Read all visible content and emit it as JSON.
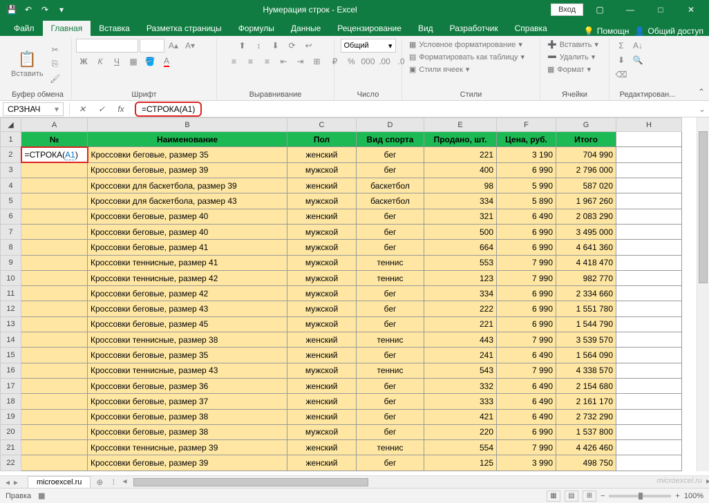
{
  "title": "Нумерация строк  -  Excel",
  "signin": "Вход",
  "tabs": {
    "file": "Файл",
    "home": "Главная",
    "insert": "Вставка",
    "layout": "Разметка страницы",
    "formulas": "Формулы",
    "data": "Данные",
    "review": "Рецензирование",
    "view": "Вид",
    "developer": "Разработчик",
    "help": "Справка"
  },
  "ribbon_help": {
    "tell": "Помощн",
    "share": "Общий доступ"
  },
  "ribbon": {
    "clipboard": {
      "paste": "Вставить",
      "label": "Буфер обмена"
    },
    "font": {
      "label": "Шрифт",
      "bold": "Ж",
      "italic": "К",
      "underline": "Ч"
    },
    "align": {
      "label": "Выравнивание"
    },
    "number": {
      "box": "Общий",
      "label": "Число"
    },
    "styles": {
      "cond": "Условное форматирование",
      "table": "Форматировать как таблицу",
      "cell": "Стили ячеек",
      "label": "Стили"
    },
    "cells": {
      "insert": "Вставить",
      "delete": "Удалить",
      "format": "Формат",
      "label": "Ячейки"
    },
    "editing": {
      "label": "Редактирован..."
    }
  },
  "namebox": "СРЗНАЧ",
  "fx_label": "fx",
  "formula": "=СТРОКА(A1)",
  "formula_prefix": "=СТРОКА(",
  "formula_ref": "A1",
  "formula_suffix": ")",
  "columns": [
    "A",
    "B",
    "C",
    "D",
    "E",
    "F",
    "G",
    "H"
  ],
  "headers": {
    "A": "№",
    "B": "Наименование",
    "C": "Пол",
    "D": "Вид спорта",
    "E": "Продано, шт.",
    "F": "Цена, руб.",
    "G": "Итого"
  },
  "active_cell_text": "=СТРОКА(",
  "active_cell_ref": "A1",
  "active_cell_suffix": ")",
  "rows": [
    {
      "n": 2,
      "b": "Кроссовки беговые, размер 35",
      "c": "женский",
      "d": "бег",
      "e": "221",
      "f": "3 190",
      "g": "704 990"
    },
    {
      "n": 3,
      "b": "Кроссовки беговые, размер 39",
      "c": "мужской",
      "d": "бег",
      "e": "400",
      "f": "6 990",
      "g": "2 796 000"
    },
    {
      "n": 4,
      "b": "Кроссовки для баскетбола, размер 39",
      "c": "женский",
      "d": "баскетбол",
      "e": "98",
      "f": "5 990",
      "g": "587 020"
    },
    {
      "n": 5,
      "b": "Кроссовки для баскетбола, размер 43",
      "c": "мужской",
      "d": "баскетбол",
      "e": "334",
      "f": "5 890",
      "g": "1 967 260"
    },
    {
      "n": 6,
      "b": "Кроссовки беговые, размер 40",
      "c": "женский",
      "d": "бег",
      "e": "321",
      "f": "6 490",
      "g": "2 083 290"
    },
    {
      "n": 7,
      "b": "Кроссовки беговые, размер 40",
      "c": "мужской",
      "d": "бег",
      "e": "500",
      "f": "6 990",
      "g": "3 495 000"
    },
    {
      "n": 8,
      "b": "Кроссовки беговые, размер 41",
      "c": "мужской",
      "d": "бег",
      "e": "664",
      "f": "6 990",
      "g": "4 641 360"
    },
    {
      "n": 9,
      "b": "Кроссовки теннисные, размер 41",
      "c": "мужской",
      "d": "теннис",
      "e": "553",
      "f": "7 990",
      "g": "4 418 470"
    },
    {
      "n": 10,
      "b": "Кроссовки теннисные, размер 42",
      "c": "мужской",
      "d": "теннис",
      "e": "123",
      "f": "7 990",
      "g": "982 770"
    },
    {
      "n": 11,
      "b": "Кроссовки беговые, размер 42",
      "c": "мужской",
      "d": "бег",
      "e": "334",
      "f": "6 990",
      "g": "2 334 660"
    },
    {
      "n": 12,
      "b": "Кроссовки беговые, размер 43",
      "c": "мужской",
      "d": "бег",
      "e": "222",
      "f": "6 990",
      "g": "1 551 780"
    },
    {
      "n": 13,
      "b": "Кроссовки беговые, размер 45",
      "c": "мужской",
      "d": "бег",
      "e": "221",
      "f": "6 990",
      "g": "1 544 790"
    },
    {
      "n": 14,
      "b": "Кроссовки теннисные, размер 38",
      "c": "женский",
      "d": "теннис",
      "e": "443",
      "f": "7 990",
      "g": "3 539 570"
    },
    {
      "n": 15,
      "b": "Кроссовки беговые, размер 35",
      "c": "женский",
      "d": "бег",
      "e": "241",
      "f": "6 490",
      "g": "1 564 090"
    },
    {
      "n": 16,
      "b": "Кроссовки теннисные, размер 43",
      "c": "мужской",
      "d": "теннис",
      "e": "543",
      "f": "7 990",
      "g": "4 338 570"
    },
    {
      "n": 17,
      "b": "Кроссовки беговые, размер 36",
      "c": "женский",
      "d": "бег",
      "e": "332",
      "f": "6 490",
      "g": "2 154 680"
    },
    {
      "n": 18,
      "b": "Кроссовки беговые, размер 37",
      "c": "женский",
      "d": "бег",
      "e": "333",
      "f": "6 490",
      "g": "2 161 170"
    },
    {
      "n": 19,
      "b": "Кроссовки беговые, размер 38",
      "c": "женский",
      "d": "бег",
      "e": "421",
      "f": "6 490",
      "g": "2 732 290"
    },
    {
      "n": 20,
      "b": "Кроссовки беговые, размер 38",
      "c": "мужской",
      "d": "бег",
      "e": "220",
      "f": "6 990",
      "g": "1 537 800"
    },
    {
      "n": 21,
      "b": "Кроссовки теннисные, размер 39",
      "c": "женский",
      "d": "теннис",
      "e": "554",
      "f": "7 990",
      "g": "4 426 460"
    },
    {
      "n": 22,
      "b": "Кроссовки беговые, размер 39",
      "c": "женский",
      "d": "бег",
      "e": "125",
      "f": "3 990",
      "g": "498 750"
    }
  ],
  "sheet_tab": "microexcel.ru",
  "status": "Правка",
  "zoom": "100%",
  "watermark": "microexcel.ru"
}
